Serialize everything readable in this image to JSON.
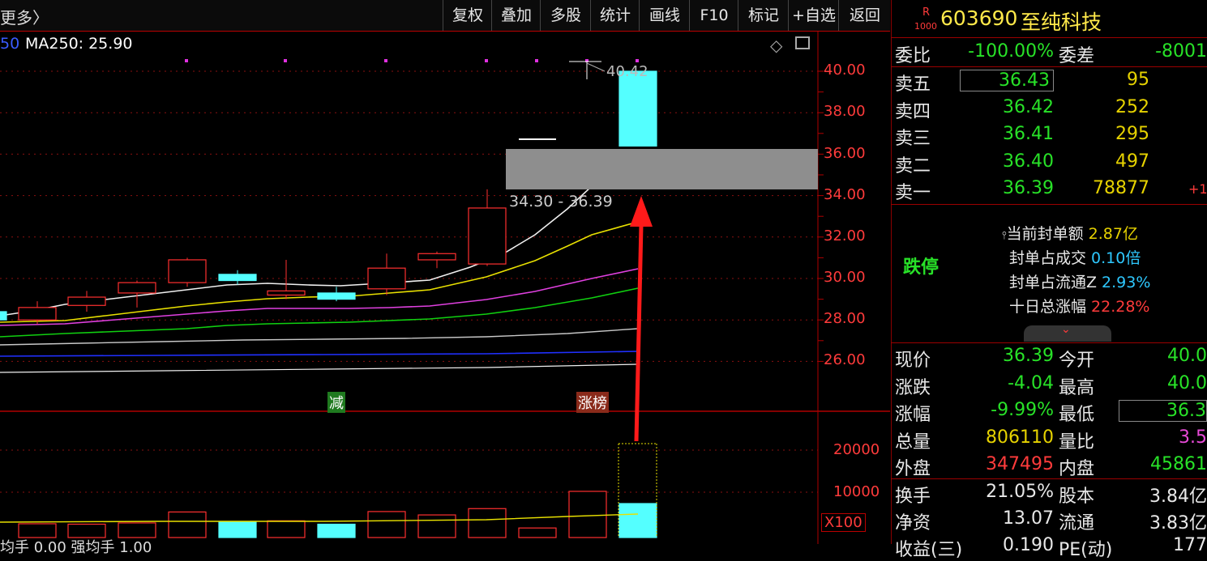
{
  "toolbar": {
    "more_label": "更多〉",
    "buttons": [
      "复权",
      "叠加",
      "多股",
      "统计",
      "画线",
      "F10",
      "标记",
      "+自选",
      "返回"
    ]
  },
  "legend": {
    "ma_prefix": "50",
    "ma250": "MA250: 25.90"
  },
  "chart": {
    "price_ticks": [
      "40.00",
      "38.00",
      "36.00",
      "34.00",
      "32.00",
      "30.00",
      "28.00",
      "26.00"
    ],
    "high_label": "40.42",
    "zone_label": "34.30 - 36.39",
    "tag_reduce": "减",
    "tag_limit": "涨榜",
    "vol_ticks": [
      "20000",
      "10000"
    ],
    "vol_unit": "X100",
    "bottom_text": "均手 0.00 强均手 1.00"
  },
  "chart_data": {
    "type": "candlestick",
    "y_ticks": [
      40.0,
      38.0,
      36.0,
      34.0,
      32.0,
      30.0,
      28.0,
      26.0
    ],
    "candles": [
      {
        "o": 28.4,
        "h": 28.6,
        "l": 28.0,
        "c": 28.0,
        "up": false
      },
      {
        "o": 28.0,
        "h": 28.9,
        "l": 27.8,
        "c": 28.6,
        "up": true
      },
      {
        "o": 28.7,
        "h": 29.4,
        "l": 28.4,
        "c": 29.1,
        "up": true
      },
      {
        "o": 29.3,
        "h": 29.9,
        "l": 28.6,
        "c": 29.8,
        "up": true
      },
      {
        "o": 29.8,
        "h": 31.0,
        "l": 29.6,
        "c": 30.9,
        "up": true
      },
      {
        "o": 30.2,
        "h": 30.4,
        "l": 29.7,
        "c": 29.9,
        "up": false
      },
      {
        "o": 29.2,
        "h": 30.9,
        "l": 29.0,
        "c": 29.4,
        "up": true
      },
      {
        "o": 29.3,
        "h": 29.6,
        "l": 28.9,
        "c": 29.0,
        "up": false
      },
      {
        "o": 29.5,
        "h": 31.2,
        "l": 29.2,
        "c": 30.5,
        "up": true
      },
      {
        "o": 30.9,
        "h": 31.3,
        "l": 30.5,
        "c": 31.2,
        "up": true
      },
      {
        "o": 30.7,
        "h": 34.3,
        "l": 30.6,
        "c": 33.4,
        "up": true
      },
      {
        "o": 36.7,
        "h": 36.7,
        "l": 36.7,
        "c": 36.7,
        "up": true
      },
      {
        "o": 40.42,
        "h": 40.42,
        "l": 40.42,
        "c": 40.42,
        "up": true
      },
      {
        "o": 40.0,
        "h": 40.0,
        "l": 36.39,
        "c": 36.39,
        "up": false
      }
    ],
    "volumes": [
      2000,
      2500,
      2400,
      2700,
      5300,
      2900,
      3200,
      2400,
      5400,
      4600,
      6100,
      1500,
      10200,
      7300
    ]
  },
  "panel": {
    "code": "603690",
    "name": "至纯科技",
    "badge_top": "R",
    "badge_bottom": "1000",
    "weibi_label": "委比",
    "weibi": "-100.00%",
    "weicha_label": "委差",
    "weicha": "-8001",
    "asks": [
      {
        "label": "卖五",
        "price": "36.43",
        "vol": "95",
        "extra": ""
      },
      {
        "label": "卖四",
        "price": "36.42",
        "vol": "252",
        "extra": ""
      },
      {
        "label": "卖三",
        "price": "36.41",
        "vol": "295",
        "extra": ""
      },
      {
        "label": "卖二",
        "price": "36.40",
        "vol": "497",
        "extra": ""
      },
      {
        "label": "卖一",
        "price": "36.39",
        "vol": "78877",
        "extra": "+1"
      }
    ],
    "limit_status": "跌停",
    "seal": [
      {
        "label": "当前封单额",
        "value": "2.87亿",
        "color": "#e6d200"
      },
      {
        "label": "封单占成交",
        "value": "0.10倍",
        "color": "#2ec8ff"
      },
      {
        "label": "封单占流通Z",
        "value": "2.93%",
        "color": "#2ec8ff"
      },
      {
        "label": "十日总涨幅",
        "value": "22.28%",
        "color": "#ff3b3b"
      }
    ],
    "quote_rows": [
      {
        "l1": "现价",
        "v1": "36.39",
        "c1": "#28e228",
        "l2": "今开",
        "v2": "40.0",
        "c2": "#28e228"
      },
      {
        "l1": "涨跌",
        "v1": "-4.04",
        "c1": "#28e228",
        "l2": "最高",
        "v2": "40.0",
        "c2": "#28e228"
      },
      {
        "l1": "涨幅",
        "v1": "-9.99%",
        "c1": "#28e228",
        "l2": "最低",
        "v2": "36.3",
        "c2": "#28e228"
      },
      {
        "l1": "总量",
        "v1": "806110",
        "c1": "#e6d200",
        "l2": "量比",
        "v2": "3.5",
        "c2": "#e84ad8"
      },
      {
        "l1": "外盘",
        "v1": "347495",
        "c1": "#ff3b3b",
        "l2": "内盘",
        "v2": "45861",
        "c2": "#28e228"
      }
    ],
    "stock_rows": [
      {
        "l1": "换手",
        "v1": "21.05%",
        "l2": "股本",
        "v2": "3.84亿"
      },
      {
        "l1": "净资",
        "v1": "13.07",
        "l2": "流通",
        "v2": "3.83亿"
      },
      {
        "l1": "收益(三)",
        "v1": "0.190",
        "l2": "PE(动)",
        "v2": "177"
      }
    ]
  }
}
